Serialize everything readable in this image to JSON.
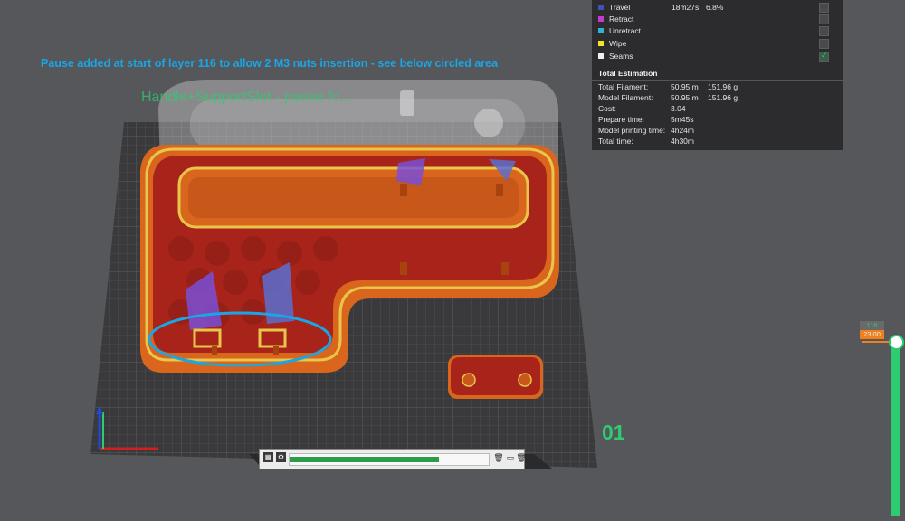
{
  "annotations": {
    "pause_note": "Pause added at start of layer 116 to allow 2 M3 nuts insertion - see below circled area",
    "plate_label": "Handle+SupportSlot - pause fo...",
    "plate_number": "01"
  },
  "legend": {
    "items": [
      {
        "label": "Travel",
        "time": "18m27s",
        "percent": "6.8%",
        "color": "#3f51b5",
        "checked": false
      },
      {
        "label": "Retract",
        "time": "",
        "percent": "",
        "color": "#c63ad1",
        "checked": false
      },
      {
        "label": "Unretract",
        "time": "",
        "percent": "",
        "color": "#2fb4d6",
        "checked": false
      },
      {
        "label": "Wipe",
        "time": "",
        "percent": "",
        "color": "#f0e81e",
        "checked": false
      },
      {
        "label": "Seams",
        "time": "",
        "percent": "",
        "color": "#f0f0f0",
        "checked": true
      }
    ]
  },
  "estimation": {
    "title": "Total Estimation",
    "rows": [
      {
        "label": "Total Filament:",
        "value": "50.95 m",
        "value2": "151.96 g"
      },
      {
        "label": "Model Filament:",
        "value": "50.95 m",
        "value2": "151.96 g"
      },
      {
        "label": "Cost:",
        "value": "3.04",
        "value2": ""
      },
      {
        "label": "Prepare time:",
        "value": "5m45s",
        "value2": ""
      },
      {
        "label": "Model printing time:",
        "value": "4h24m",
        "value2": ""
      },
      {
        "label": "Total time:",
        "value": "4h30m",
        "value2": ""
      }
    ]
  },
  "layer_slider": {
    "layer": "116",
    "height": "23.00"
  },
  "toolbar": {
    "progress": 0.75
  },
  "colors": {
    "accent_green": "#2ecc71",
    "accent_orange": "#f07f1d",
    "annotation_blue": "#19a6e6",
    "wall_orange": "#d9661c",
    "infill_red": "#a8241a"
  }
}
